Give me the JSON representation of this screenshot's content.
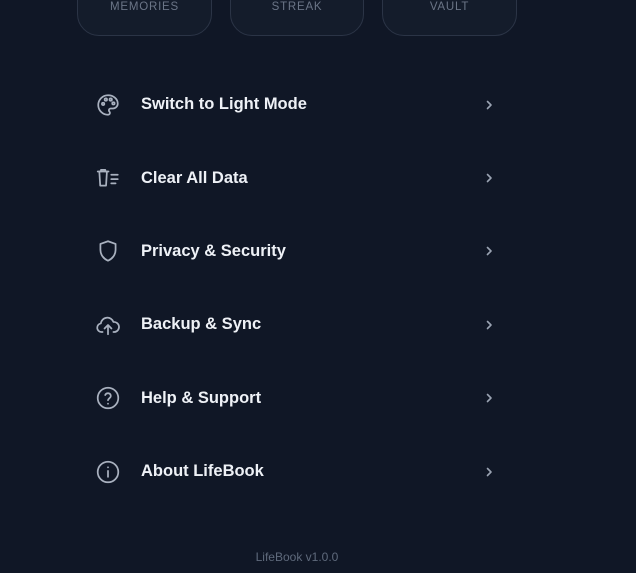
{
  "stats": [
    {
      "label": "MEMORIES"
    },
    {
      "label": "STREAK"
    },
    {
      "label": "VAULT"
    }
  ],
  "settings": {
    "items": [
      {
        "label": "Switch to Light Mode",
        "icon": "palette-icon"
      },
      {
        "label": "Clear All Data",
        "icon": "trash-list-icon"
      },
      {
        "label": "Privacy & Security",
        "icon": "shield-icon"
      },
      {
        "label": "Backup & Sync",
        "icon": "cloud-upload-icon"
      },
      {
        "label": "Help & Support",
        "icon": "help-circle-icon"
      },
      {
        "label": "About LifeBook",
        "icon": "info-circle-icon"
      }
    ]
  },
  "footer": {
    "version": "LifeBook v1.0.0"
  },
  "colors": {
    "background": "#101726",
    "text": "#eef1f6",
    "icon": "#a9b1bf",
    "muted": "#5f6a7c"
  }
}
